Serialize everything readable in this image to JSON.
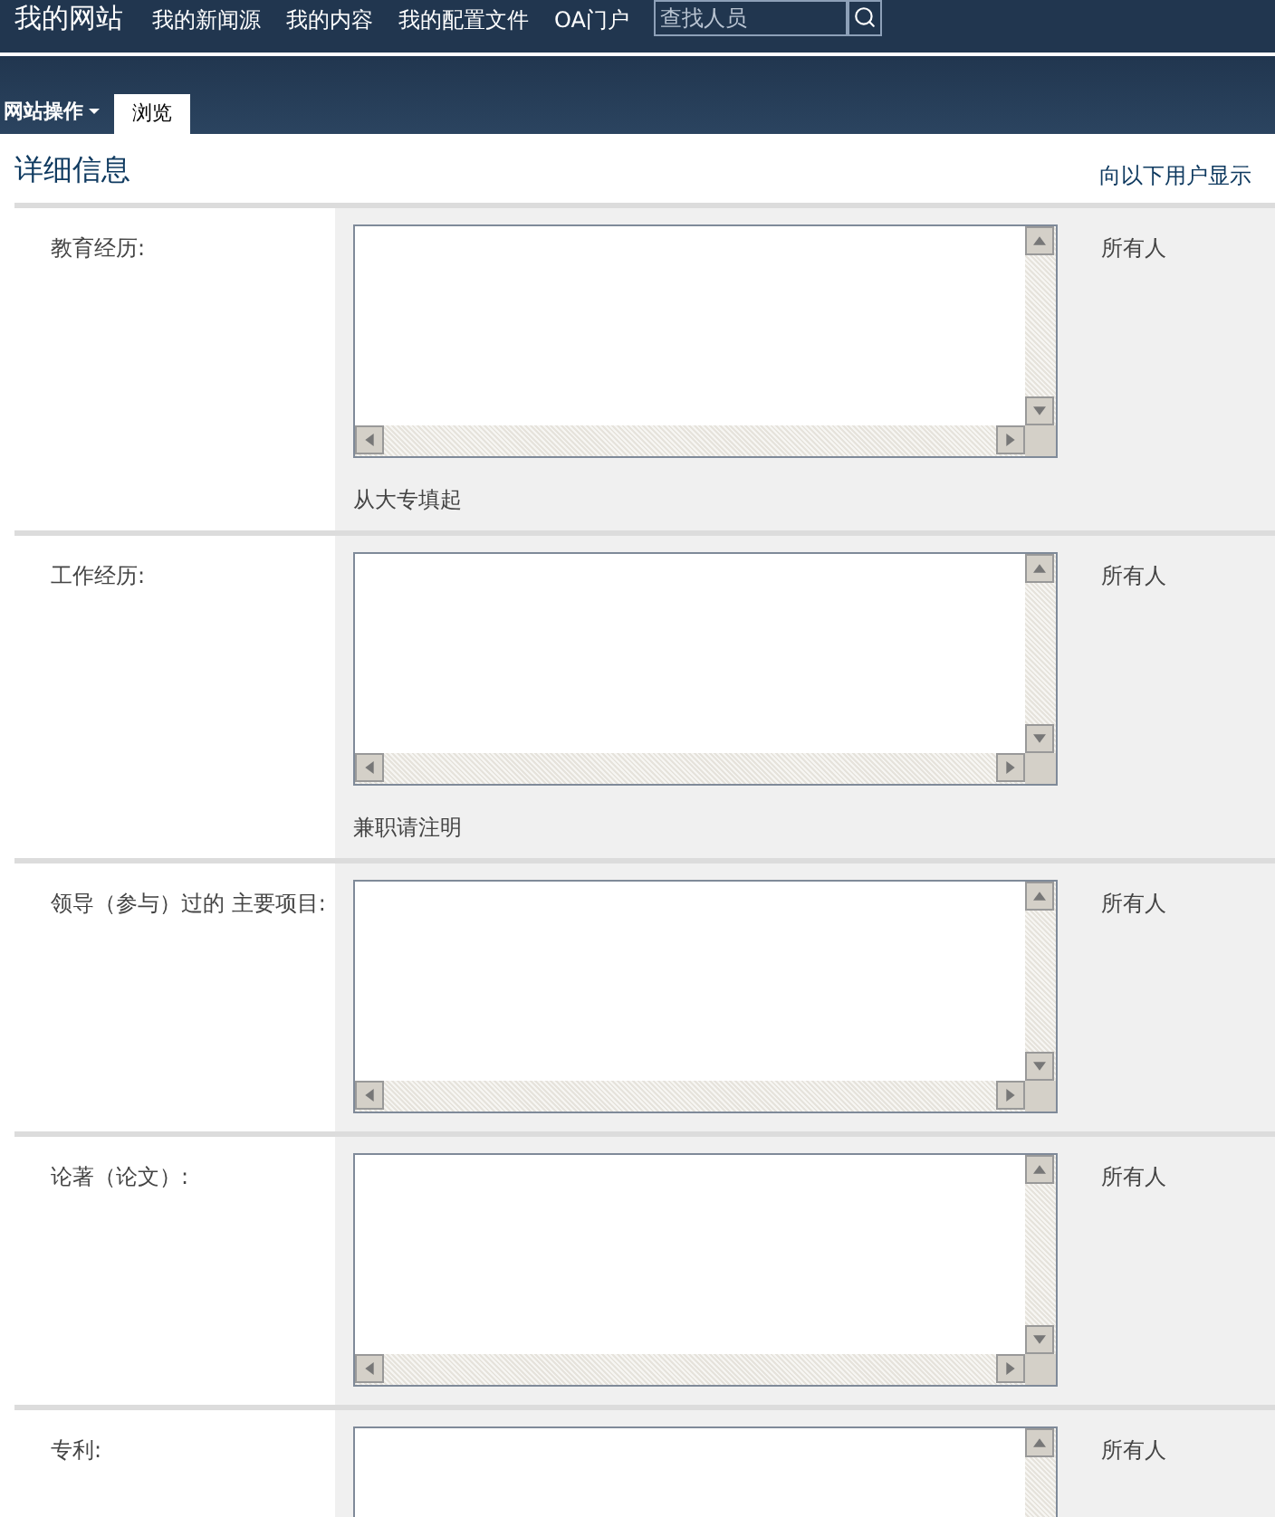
{
  "top_bar": {
    "site_title": "我的网站",
    "links": [
      "我的新闻源",
      "我的内容",
      "我的配置文件",
      "OA门户"
    ],
    "search": {
      "placeholder": "查找人员"
    }
  },
  "ribbon": {
    "menu": "网站操作",
    "tabs": [
      {
        "label": "浏览",
        "selected": true
      }
    ]
  },
  "section": {
    "title": "详细信息",
    "visibility_header": "向以下用户显示"
  },
  "fields": [
    {
      "label": "教育经历:",
      "hint": "从大专填起",
      "visibility": "所有人"
    },
    {
      "label": "工作经历:",
      "hint": "兼职请注明",
      "visibility": "所有人"
    },
    {
      "label": "领导（参与）过的 主要项目:",
      "visibility": "所有人"
    },
    {
      "label": "论著（论文）:",
      "visibility": "所有人"
    },
    {
      "label": "专利:",
      "visibility": "所有人"
    }
  ]
}
